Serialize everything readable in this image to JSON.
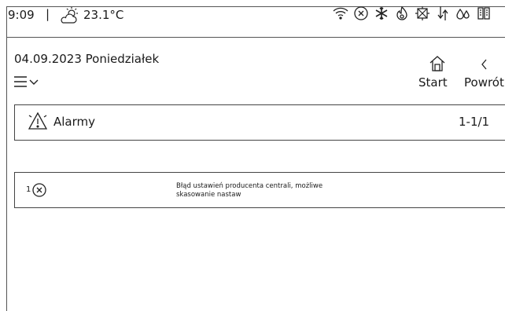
{
  "status_bar": {
    "time": "9:09",
    "separator": "|",
    "weather_icon": "partly-cloudy-icon",
    "temperature": "23.1°C",
    "icons": [
      "wifi-icon",
      "error-circle-icon",
      "snowflake-icon",
      "flame-icon",
      "heat-exchanger-icon",
      "airflow-icon",
      "humidity-icon",
      "filter-icon"
    ]
  },
  "header": {
    "date": "04.09.2023 Poniedziałek",
    "menu_icon": "hamburger-icon",
    "start_label": "Start",
    "back_label": "Powrót"
  },
  "alarms_panel": {
    "title": "Alarmy",
    "count": "1-1/1",
    "icon": "warning-icon"
  },
  "alarms": [
    {
      "number": "1",
      "icon": "error-circle-icon",
      "text": "Błąd ustawień producenta centrali, możliwe skasowanie nastaw"
    }
  ],
  "colors": {
    "border": "#444444",
    "text": "#1a1a1a",
    "background": "#ffffff"
  }
}
